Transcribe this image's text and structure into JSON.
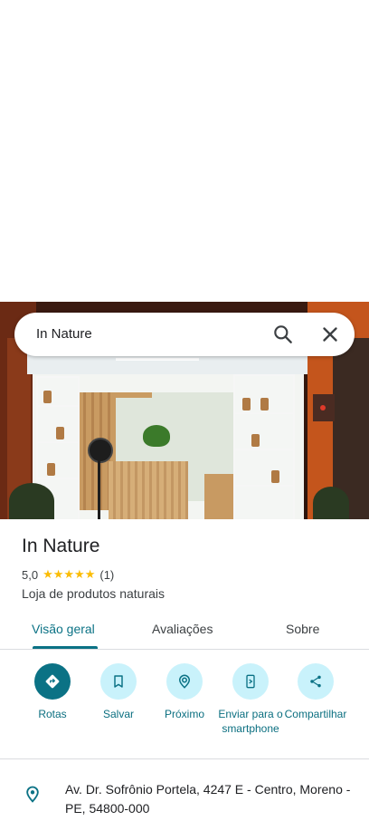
{
  "search": {
    "query": "In Nature"
  },
  "place": {
    "name": "In Nature",
    "rating": "5,0",
    "stars": "★★★★★",
    "review_count": "(1)",
    "category": "Loja de produtos naturais"
  },
  "tabs": [
    {
      "label": "Visão geral",
      "active": true
    },
    {
      "label": "Avaliações",
      "active": false
    },
    {
      "label": "Sobre",
      "active": false
    }
  ],
  "actions": [
    {
      "label": "Rotas",
      "icon": "directions-icon"
    },
    {
      "label": "Salvar",
      "icon": "bookmark-icon"
    },
    {
      "label": "Próximo",
      "icon": "nearby-icon"
    },
    {
      "label": "Enviar para o smartphone",
      "icon": "send-to-phone-icon"
    },
    {
      "label": "Compartilhar",
      "icon": "share-icon"
    }
  ],
  "address": {
    "text": "Av. Dr. Sofrônio Portela, 4247 E - Centro, Moreno - PE, 54800-000"
  },
  "colors": {
    "accent": "#0b7285",
    "action_bg": "#c9f2fb",
    "star": "#fbbc04"
  }
}
